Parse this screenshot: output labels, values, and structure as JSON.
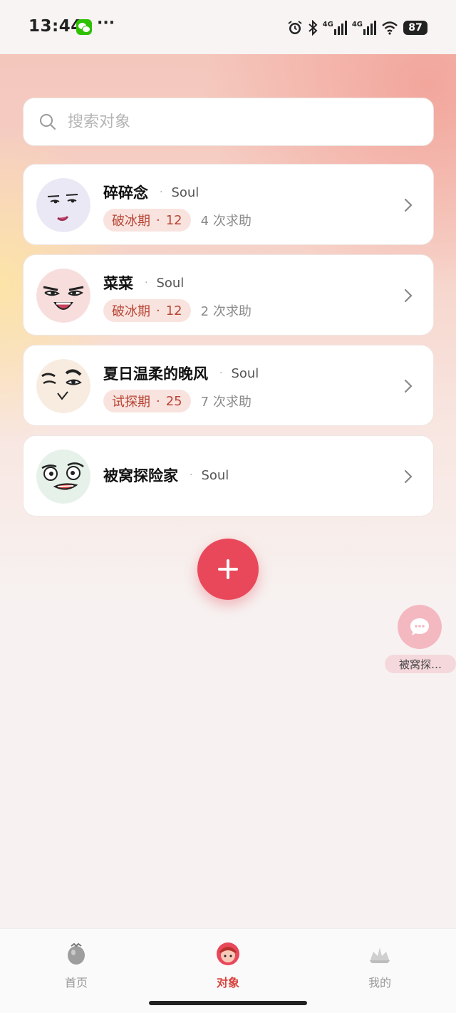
{
  "status_bar": {
    "time": "13:44",
    "more": "···",
    "network_1": "4G",
    "network_2": "4G",
    "battery": "87"
  },
  "search": {
    "placeholder": "搜索对象"
  },
  "contacts": [
    {
      "name": "碎碎念",
      "platform": "Soul",
      "stage": "破冰期",
      "stage_sep": "·",
      "score": "12",
      "help_count": "4 次求助"
    },
    {
      "name": "菜菜",
      "platform": "Soul",
      "stage": "破冰期",
      "stage_sep": "·",
      "score": "12",
      "help_count": "2 次求助"
    },
    {
      "name": "夏日温柔的晚风",
      "platform": "Soul",
      "stage": "试探期",
      "stage_sep": "·",
      "score": "25",
      "help_count": "7 次求助"
    },
    {
      "name": "被窝探险家",
      "platform": "Soul"
    }
  ],
  "separator": "·",
  "floating_chat": {
    "label": "被窝探…"
  },
  "tab_bar": {
    "items": [
      {
        "label": "首页",
        "icon": "home-egg-icon"
      },
      {
        "label": "对象",
        "icon": "partner-avatar-icon"
      },
      {
        "label": "我的",
        "icon": "profile-icon"
      }
    ],
    "active": "对象"
  },
  "colors": {
    "accent": "#e8485a",
    "badge_bg": "#f9e3df",
    "badge_text": "#b84534",
    "active_tab": "#d8443f"
  }
}
